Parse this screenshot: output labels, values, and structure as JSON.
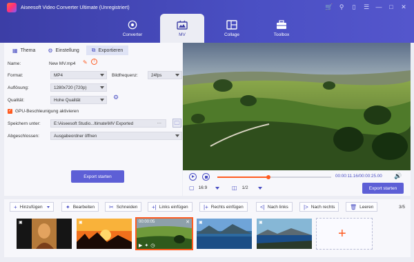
{
  "app": {
    "title": "Aiseesoft Video Converter Ultimate (Unregistriert)"
  },
  "window_icons": [
    "cart-icon",
    "key-icon",
    "chat-icon",
    "menu-icon",
    "minimize-icon",
    "maximize-icon",
    "close-icon"
  ],
  "nav": [
    {
      "label": "Converter",
      "icon": "converter-icon"
    },
    {
      "label": "MV",
      "icon": "mv-icon"
    },
    {
      "label": "Collage",
      "icon": "collage-icon"
    },
    {
      "label": "Toolbox",
      "icon": "toolbox-icon"
    }
  ],
  "nav_active": "MV",
  "tabs": [
    {
      "label": "Thema",
      "icon": "theme-icon"
    },
    {
      "label": "Einstellung",
      "icon": "gear-icon"
    },
    {
      "label": "Exportieren",
      "icon": "export-icon"
    }
  ],
  "tab_active": "Exportieren",
  "export_form": {
    "name_label": "Name:",
    "name_value": "New MV.mp4",
    "format_label": "Format:",
    "format_value": "MP4",
    "framerate_label": "Bildfrequenz:",
    "framerate_value": "24fps",
    "resolution_label": "Auflösung:",
    "resolution_value": "1280x720 (720p)",
    "quality_label": "Qualität:",
    "quality_value": "Hohe Qualität",
    "gpu_label": "GPU-Beschleunigung aktivieren",
    "gpu_checked": true,
    "save_label": "Speichern unter:",
    "save_value": "E:\\Aiseesoft Studio...ltimate\\MV Exported",
    "save_more": "···",
    "done_label": "Abgeschlossen:",
    "done_value": "Ausgabeordner öffnen",
    "export_button": "Export starten"
  },
  "player": {
    "time": "00:00:11.16/00:00:25.00",
    "progress": 0.45,
    "aspect": "16:9",
    "page": "1/2",
    "export_button": "Export starten"
  },
  "toolbar": {
    "add": "Hinzufügen",
    "edit": "Bearbeiten",
    "cut": "Schneiden",
    "insert_left": "Links einfügen",
    "insert_right": "Rechts einfügen",
    "move_left": "Nach links",
    "move_right": "Nach rechts",
    "clear": "Leeren",
    "count": "3/5"
  },
  "timeline": {
    "active_duration": "00:00:05",
    "clips": [
      "portrait-scene",
      "sunset-scene",
      "landscape-scene",
      "lake-scene",
      "mountain-lake-scene"
    ],
    "active_index": 2
  },
  "colors": {
    "brand": "#4a4fc3",
    "accent": "#ff5a1f",
    "button": "#5d5fd6"
  }
}
